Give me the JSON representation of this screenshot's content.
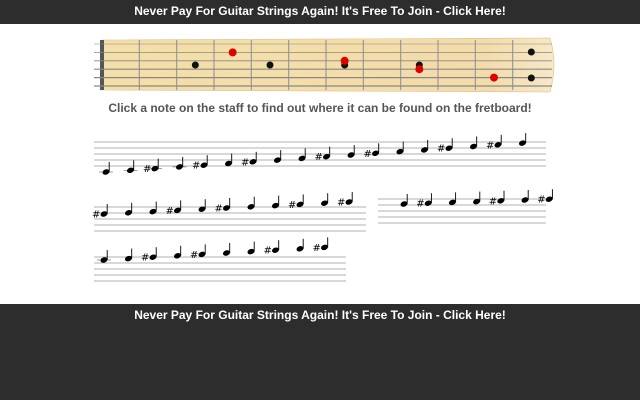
{
  "banner": {
    "top_text": "Never Pay For Guitar Strings Again! It's Free To Join - Click Here!",
    "bottom_text": "Never Pay For Guitar Strings Again! It's Free To Join - Click Here!"
  },
  "fretboard": {
    "strings": 6,
    "frets": 12,
    "inlay_frets": [
      3,
      5,
      7,
      9,
      12
    ],
    "highlighted_notes": [
      {
        "string": 1,
        "fret": 4
      },
      {
        "string": 2,
        "fret": 7
      },
      {
        "string": 3,
        "fret": 9
      },
      {
        "string": 4,
        "fret": 11
      }
    ],
    "colors": {
      "wood": "#f5dfa8",
      "inlay": "#111111",
      "highlight": "#e00000"
    }
  },
  "instruction_text": "Click a note on the staff to find out where it can be found on the fretboard!",
  "staff": {
    "rows": [
      {
        "notes": [
          "",
          "",
          "#",
          "",
          "#",
          "",
          "#",
          "",
          "",
          "#",
          "",
          "#",
          "",
          "",
          "#",
          "",
          "#",
          ""
        ]
      },
      {
        "notes": [
          "#",
          "",
          "",
          "#",
          "",
          "#",
          "",
          "",
          "#",
          "",
          "#",
          "",
          "#",
          "",
          "",
          "#",
          "",
          "#"
        ]
      },
      {
        "notes": [
          "",
          "",
          "#",
          "",
          "#",
          "",
          "",
          "#",
          "",
          "#"
        ]
      }
    ]
  }
}
